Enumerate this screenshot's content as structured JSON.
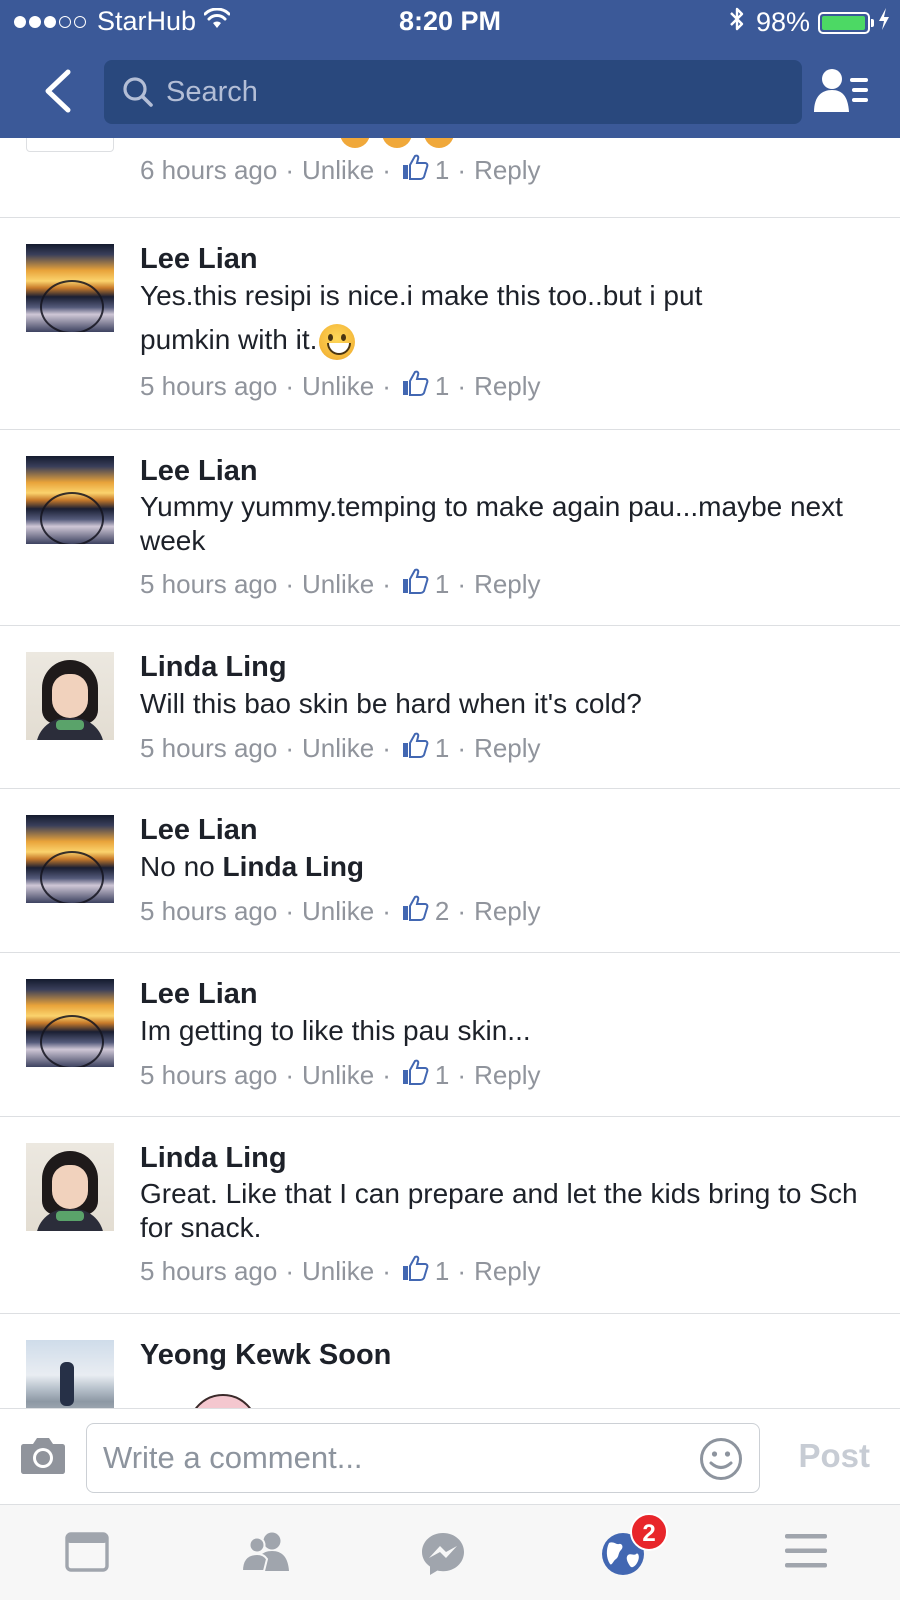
{
  "status_bar": {
    "carrier": "StarHub",
    "time": "8:20 PM",
    "battery": "98%",
    "battery_level": 0.98,
    "signal_bars_filled": 3,
    "signal_bars_total": 5
  },
  "nav": {
    "search_placeholder": "Search"
  },
  "colors": {
    "brand": "#3b5998",
    "search_bg": "#29487d",
    "link_blue": "#4267b2",
    "badge_red": "#e8262b",
    "meta_gray": "#90949c"
  },
  "comments": [
    {
      "author": "",
      "text": "",
      "time": "6 hours ago",
      "action": "Unlike",
      "likes": "1",
      "reply": "Reply"
    },
    {
      "author": "Lee Lian",
      "text_line1": "Yes.this resipi is nice.i make this too..but i put",
      "text_line2": "pumkin with it.",
      "emoji": "grinning-face",
      "time": "5 hours ago",
      "action": "Unlike",
      "likes": "1",
      "reply": "Reply"
    },
    {
      "author": "Lee Lian",
      "text": "Yummy yummy.temping to make again pau...maybe next week",
      "time": "5 hours ago",
      "action": "Unlike",
      "likes": "1",
      "reply": "Reply"
    },
    {
      "author": "Linda Ling",
      "text": "Will this bao skin be hard when it's cold?",
      "time": "5 hours ago",
      "action": "Unlike",
      "likes": "1",
      "reply": "Reply"
    },
    {
      "author": "Lee Lian",
      "text_prefix": "No no ",
      "mention": "Linda Ling",
      "time": "5 hours ago",
      "action": "Unlike",
      "likes": "2",
      "reply": "Reply"
    },
    {
      "author": "Lee Lian",
      "text": "Im getting to like this pau skin...",
      "time": "5 hours ago",
      "action": "Unlike",
      "likes": "1",
      "reply": "Reply"
    },
    {
      "author": "Linda Ling",
      "text": "Great. Like that I can prepare and let the kids bring to Sch for snack.",
      "time": "5 hours ago",
      "action": "Unlike",
      "likes": "1",
      "reply": "Reply"
    },
    {
      "author": "Yeong Kewk Soon"
    }
  ],
  "composer": {
    "placeholder": "Write a comment...",
    "post_label": "Post"
  },
  "tabbar": {
    "tabs": [
      "news-feed",
      "friends",
      "messenger",
      "notifications",
      "menu"
    ],
    "notifications_badge": "2"
  }
}
